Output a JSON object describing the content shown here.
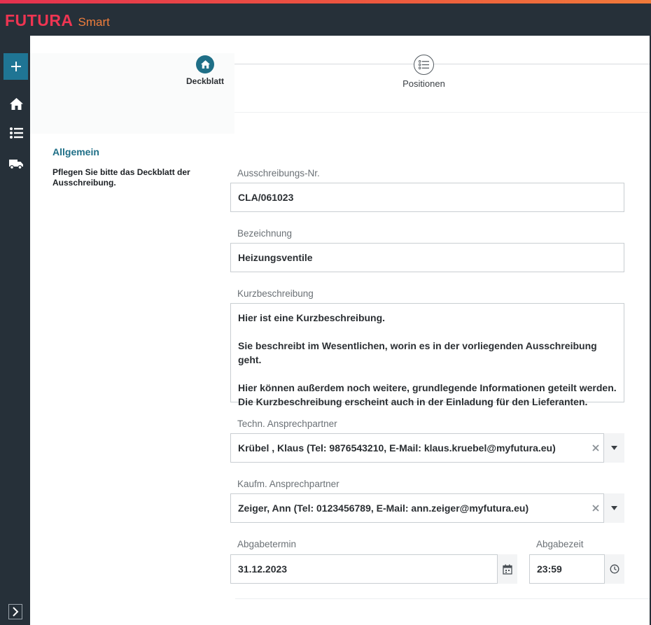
{
  "app": {
    "logo_main": "FUTURA",
    "logo_sub": "Smart",
    "accent_color": "#1f6f87",
    "brand_color": "#ee3552"
  },
  "sidebar": {
    "items": [
      {
        "icon": "plus-icon"
      },
      {
        "icon": "home-icon"
      },
      {
        "icon": "list-icon"
      },
      {
        "icon": "truck-icon"
      },
      {
        "icon": "chevron-right-icon"
      }
    ]
  },
  "stepper": {
    "steps": [
      {
        "label": "Deckblatt",
        "icon": "home-icon",
        "active": true
      },
      {
        "label": "Positionen",
        "icon": "list-icon",
        "active": false
      }
    ]
  },
  "section": {
    "title": "Allgemein",
    "description": "Pflegen Sie bitte das Deckblatt der Ausschreibung."
  },
  "form": {
    "ausschreibungs_nr": {
      "label": "Ausschreibungs-Nr.",
      "value": "CLA/061023"
    },
    "bezeichnung": {
      "label": "Bezeichnung",
      "value": "Heizungsventile"
    },
    "kurzbeschreibung": {
      "label": "Kurzbeschreibung",
      "value": "Hier ist eine Kurzbeschreibung.\n\nSie beschreibt im Wesentlichen, worin es in der vorliegenden Ausschreibung geht.\n\nHier können außerdem noch weitere, grundlegende Informationen geteilt werden.\nDie Kurzbeschreibung erscheint auch in der Einladung für den Lieferanten."
    },
    "techn_ansprechpartner": {
      "label": "Techn. Ansprechpartner",
      "value": "Krübel , Klaus (Tel: 9876543210, E-Mail: klaus.kruebel@myfutura.eu)"
    },
    "kaufm_ansprechpartner": {
      "label": "Kaufm. Ansprechpartner",
      "value": "Zeiger, Ann (Tel: 0123456789, E-Mail: ann.zeiger@myfutura.eu)"
    },
    "abgabetermin": {
      "label": "Abgabetermin",
      "value": "31.12.2023"
    },
    "abgabezeit": {
      "label": "Abgabezeit",
      "value": "23:59"
    }
  }
}
